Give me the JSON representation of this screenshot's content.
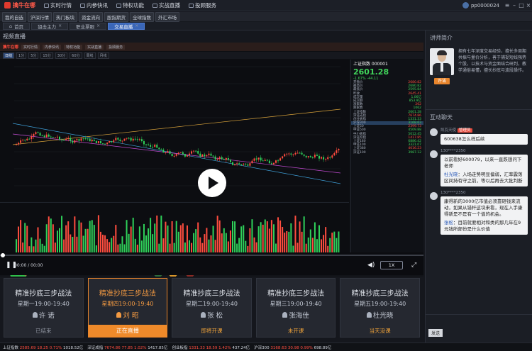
{
  "app": {
    "logo_text": "擒牛在哪",
    "user": "pp0000024"
  },
  "menu": [
    "实时行情",
    "内参快讯",
    "特权功能",
    "实战直播",
    "投顾服务"
  ],
  "subbar": [
    "我的自选",
    "沪深行情",
    "热门板块",
    "资金流向",
    "股指期货",
    "全球指数",
    "外汇市场"
  ],
  "tabs": [
    {
      "label": "首页",
      "active": false
    },
    {
      "label": "狙击主力",
      "active": false
    },
    {
      "label": "职业票眼",
      "active": false
    },
    {
      "label": "交易直播",
      "active": true
    }
  ],
  "video": {
    "title": "视频直播",
    "inner_tabs": [
      "日线",
      "1分",
      "5分",
      "15分",
      "30分",
      "60分",
      "周线",
      "月线"
    ],
    "quote": {
      "name": "上证指数 000001",
      "price": "2601.28",
      "change": "-1.67%  -44.11",
      "rows": [
        [
          "开盘价",
          "2680.82"
        ],
        [
          "最高价",
          "2680.82"
        ],
        [
          "最低价",
          "2595.84"
        ],
        [
          "昨收",
          "2645.41"
        ],
        [
          "成交量",
          "1.06亿"
        ],
        [
          "成交额",
          "853.9亿"
        ],
        [
          "涨家数",
          "262"
        ],
        [
          "跌家数",
          "1062"
        ],
        [
          "上证指数",
          "2601.28"
        ],
        [
          "深证成指",
          "7674.86"
        ],
        [
          "创业板指",
          "1331.33"
        ],
        [
          "沪深300",
          "3168.63"
        ],
        [
          "上证50",
          "2399.73"
        ],
        [
          "中证500",
          "4509.88"
        ],
        [
          "中小板指",
          "5012.45"
        ],
        [
          "深证综指",
          "1417.85"
        ],
        [
          "上证180",
          "6886.42"
        ],
        [
          "中证100",
          "3321.07"
        ],
        [
          "上证380",
          "4016.23"
        ],
        [
          "深证100",
          "3987.12"
        ]
      ]
    },
    "time": "00:00 / 00:00",
    "speed": "1X"
  },
  "cards": [
    {
      "title": "精准抄底三步战法",
      "schedule": "星期一19:00-19:40",
      "teacher": "许 诺",
      "status": "已结束",
      "state": "ended"
    },
    {
      "title": "精准抄底三步战法",
      "schedule": "星期四19:00-19:40",
      "teacher": "刘 昭",
      "status": "正在直播",
      "state": "live"
    },
    {
      "title": "精准抄底三步战法",
      "schedule": "星期二19:00-19:40",
      "teacher": "张 松",
      "status": "即将开课",
      "state": "upcoming"
    },
    {
      "title": "精准抄底三步战法",
      "schedule": "星期三19:00-19:40",
      "teacher": "张海佳",
      "status": "未开课",
      "state": "upcoming"
    },
    {
      "title": "精准抄底三步战法",
      "schedule": "星期五19:00-19:40",
      "teacher": "杜光晓",
      "status": "当天没课",
      "state": "upcoming"
    }
  ],
  "ticker": [
    {
      "name": "上证指数",
      "value": "2585.69",
      "change": "18.25",
      "pct": "0.71%",
      "amount": "1018.52亿",
      "dir": "up"
    },
    {
      "name": "深证成指",
      "value": "7674.86",
      "change": "77.85",
      "pct": "1.02%",
      "amount": "1417.85亿",
      "dir": "up"
    },
    {
      "name": "创业板指",
      "value": "1331.33",
      "change": "18.59",
      "pct": "1.42%",
      "amount": "437.24亿",
      "dir": "up"
    },
    {
      "name": "沪深300",
      "value": "3168.63",
      "change": "30.98",
      "pct": "0.99%",
      "amount": "698.89亿",
      "dir": "up"
    }
  ],
  "right": {
    "teacher_header": "讲师简介",
    "teacher_name": "许诺",
    "teacher_desc": "拥有七年深度交易经验，擅长多周期共振与量价分析，善于捕捉短线强势个股，以技术与资金面结合研判，教学通俗易懂，擅长抄底与波段操作。",
    "chat_header": "互动聊天",
    "messages": [
      {
        "who": "凯瓦天使",
        "tag": "管理员",
        "text": "600638怎么样后续"
      },
      {
        "who": "130****2350",
        "tag": "",
        "text": "以前看好600079，以来一直跌想问下老师",
        "reply_name": "杜光晓",
        "reply": "入场走势明显偏弱，汇率震荡区间持有守之前，等以后再去大批判断"
      },
      {
        "who": "130****2350",
        "tag": "",
        "text": "康得新的3000亿市值必须靠砸钱来流动，如果从错杆这块来看，现在入手康得新是不是有一个值的机会。",
        "reply_name": "张松",
        "reply": "目前就要相对和类的那几年在9元钱所部份是什么价值"
      }
    ],
    "send_label": "发送"
  }
}
